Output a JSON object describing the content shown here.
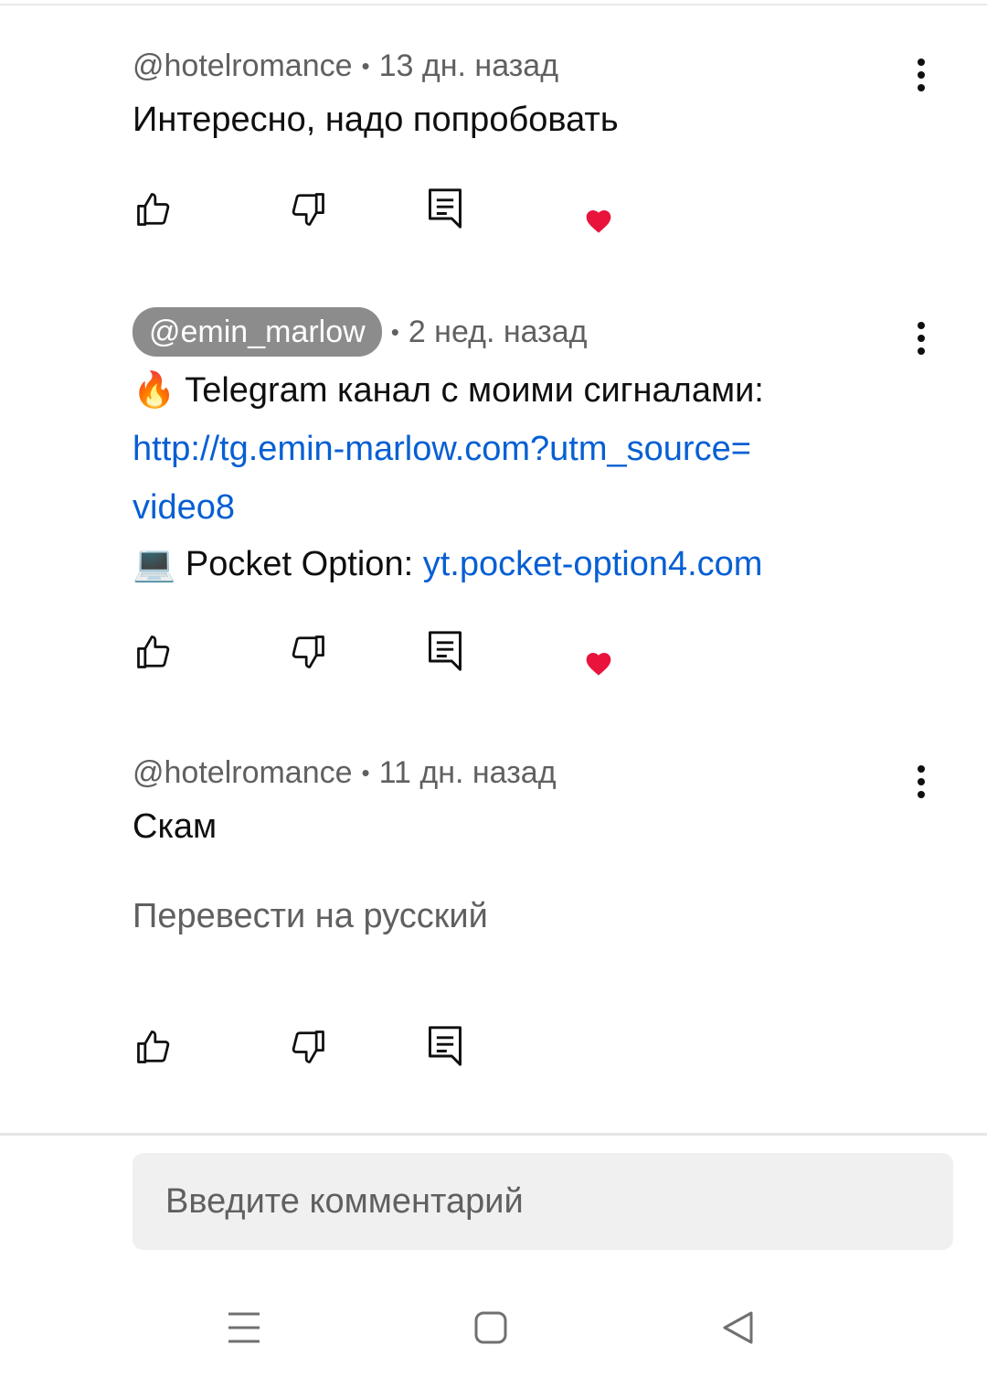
{
  "comments": [
    {
      "author": "@hotelromance",
      "time": "13 дн. назад",
      "text": "Интересно, надо попробовать"
    },
    {
      "author": "@emin_marlow",
      "time": "2 нед. назад",
      "line1_emoji": "🔥",
      "line1_text": "Telegram канал с моими сигналами:",
      "link1_part1": "http://tg.emin-marlow.com?utm_source=",
      "link1_part2": "video8",
      "line3_emoji": "💻",
      "line3_text": "Pocket Option: ",
      "link2": "yt.pocket-option4.com"
    },
    {
      "author": "@hotelromance",
      "time": "11 дн. назад",
      "text": "Скам",
      "translate": "Перевести на русский"
    }
  ],
  "meta_separator": "•",
  "input": {
    "placeholder": "Введите комментарий"
  },
  "icons": {
    "like": "thumb-up-icon",
    "dislike": "thumb-down-icon",
    "reply": "reply-comment-icon",
    "heart": "creator-heart-icon",
    "more": "more-vert-icon",
    "nav_menu": "menu-lines-icon",
    "nav_home": "home-square-icon",
    "nav_back": "back-triangle-icon"
  },
  "colors": {
    "link": "#065fd4",
    "heart": "#e8143c",
    "secondary_text": "#606060",
    "pill_bg": "#8c8c8c"
  }
}
